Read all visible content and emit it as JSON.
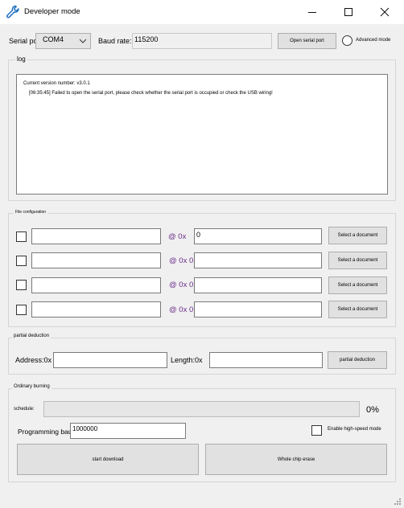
{
  "window": {
    "title": "Developer mode"
  },
  "serial": {
    "port_label": "Serial port:",
    "port_value": "COM4",
    "baud_label": "Baud rate:",
    "baud_value": "115200",
    "open_button": "Open serial port",
    "advanced_label": "Advanced mode"
  },
  "log": {
    "label": "log",
    "lines": [
      "Current version number: v3.0.1",
      "[06:35:45] Failed to open the serial port, please check whether the serial port is occupied or check the USB wiring!"
    ]
  },
  "files": {
    "label": "File configuration",
    "rows": [
      {
        "at": "@ 0x",
        "addr": "0",
        "button": "Select a document"
      },
      {
        "at": "@ 0x 0",
        "addr": "",
        "button": "Select a document"
      },
      {
        "at": "@ 0x 0",
        "addr": "",
        "button": "Select a document"
      },
      {
        "at": "@ 0x 0",
        "addr": "",
        "button": "Select a document"
      }
    ]
  },
  "partial": {
    "label": "partial deduction",
    "address_label": "Address:0x",
    "length_label": "Length:0x",
    "button": "partial deduction"
  },
  "burning": {
    "label": "Ordinary burning",
    "schedule_label": "schedule:",
    "progress": "0%",
    "baud_label": "Programming baud rate:",
    "baud_value": "1000000",
    "high_speed_label": "Enable high-speed mode",
    "start_button": "start download",
    "erase_button": "Whole chip erase"
  }
}
